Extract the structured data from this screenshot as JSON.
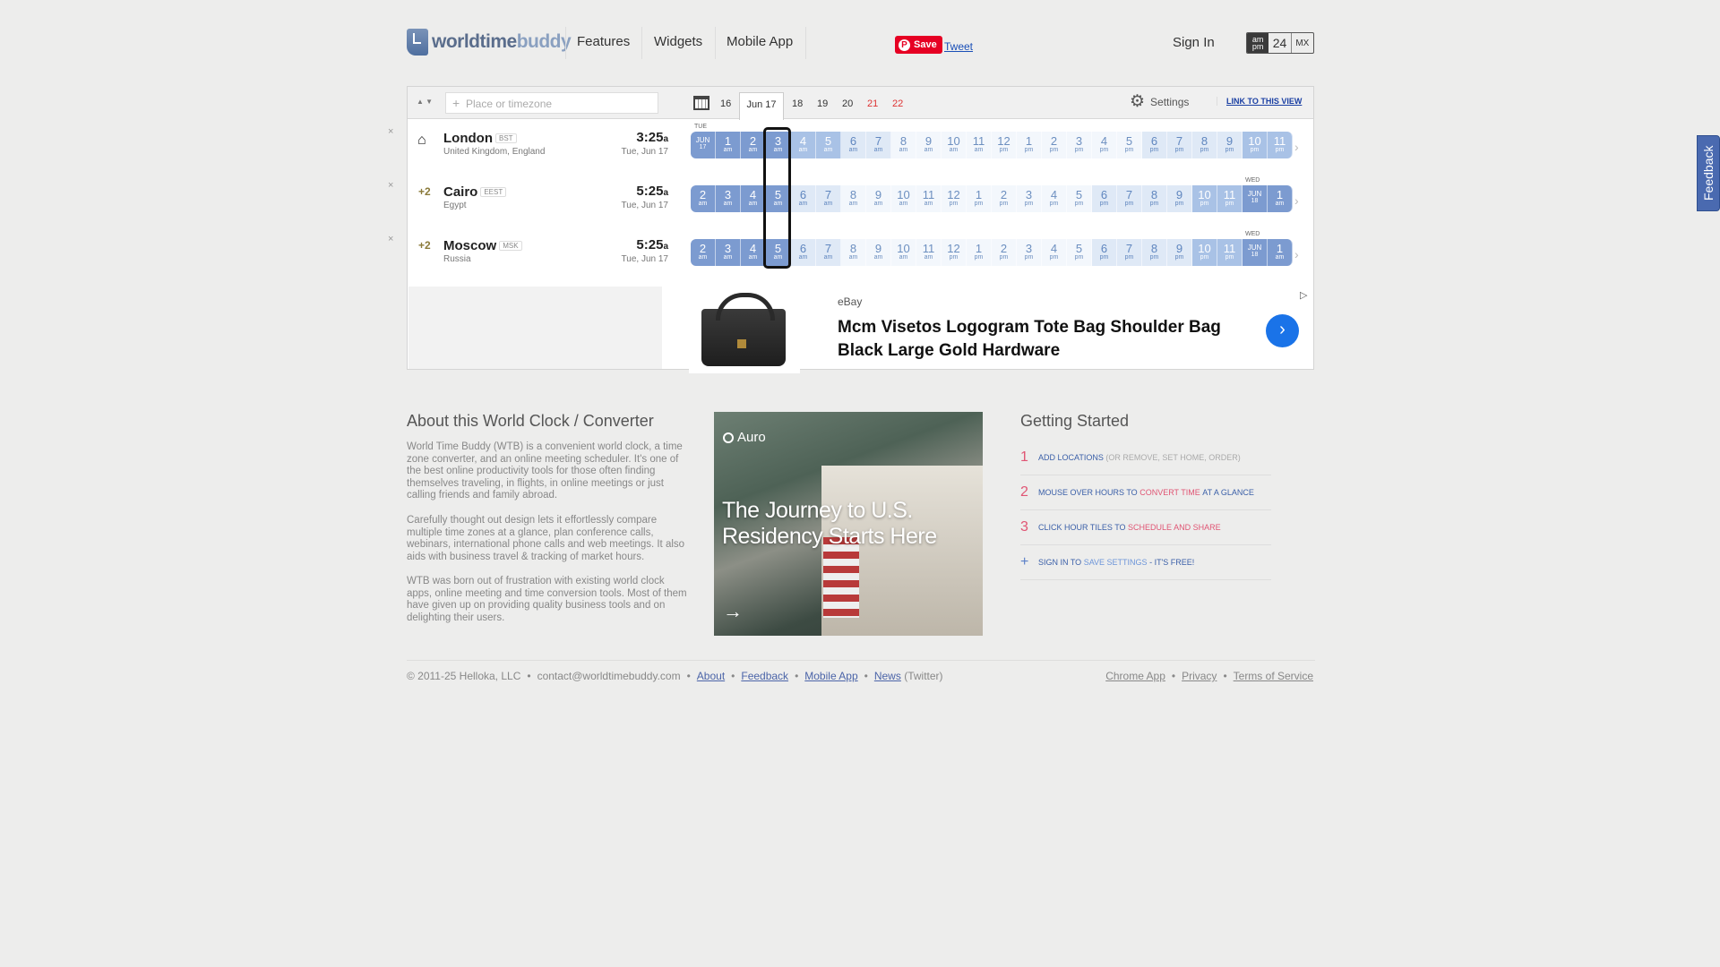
{
  "header": {
    "logo_word": "worldtime",
    "logo_word2": "buddy",
    "nav": [
      "Features",
      "Widgets",
      "Mobile App"
    ],
    "pin_label": "Save",
    "tweet_label": "Tweet",
    "signin": "Sign In",
    "format": {
      "ampm": "am pm",
      "h24": "24",
      "mx": "MX"
    }
  },
  "toolbar": {
    "search_placeholder": "Place or timezone",
    "days": [
      "16",
      "Jun 17",
      "18",
      "19",
      "20",
      "21",
      "22"
    ],
    "weekend_days": [
      "21",
      "22"
    ],
    "settings": "Settings",
    "link_view": "LINK TO THIS VIEW"
  },
  "locations": [
    {
      "diff": "",
      "city": "London",
      "tz": "BST",
      "country": "United Kingdom, England",
      "time": "3:25",
      "suffix": "a",
      "date": "Tue, Jun 17",
      "home": true
    },
    {
      "diff": "+2",
      "city": "Cairo",
      "tz": "EEST",
      "country": "Egypt",
      "time": "5:25",
      "suffix": "a",
      "date": "Tue, Jun 17"
    },
    {
      "diff": "+2",
      "city": "Moscow",
      "tz": "MSK",
      "country": "Russia",
      "time": "5:25",
      "suffix": "a",
      "date": "Tue, Jun 17"
    }
  ],
  "day_labels": {
    "tue": "TUE",
    "wed": "WED"
  },
  "row1_hours": [
    {
      "t": "JUN",
      "s": "17",
      "k": "jun"
    },
    {
      "t": "1",
      "s": "am",
      "k": "night"
    },
    {
      "t": "2",
      "s": "am",
      "k": "night"
    },
    {
      "t": "3",
      "s": "am",
      "k": "night"
    },
    {
      "t": "4",
      "s": "am",
      "k": "dawn"
    },
    {
      "t": "5",
      "s": "am",
      "k": "dawn"
    },
    {
      "t": "6",
      "s": "am",
      "k": "hd"
    },
    {
      "t": "7",
      "s": "am",
      "k": "hd"
    },
    {
      "t": "8",
      "s": "am",
      "k": "mid"
    },
    {
      "t": "9",
      "s": "am",
      "k": "mid"
    },
    {
      "t": "10",
      "s": "am",
      "k": "mid"
    },
    {
      "t": "11",
      "s": "am",
      "k": "mid"
    },
    {
      "t": "12",
      "s": "pm",
      "k": "mid"
    },
    {
      "t": "1",
      "s": "pm",
      "k": "mid"
    },
    {
      "t": "2",
      "s": "pm",
      "k": "mid"
    },
    {
      "t": "3",
      "s": "pm",
      "k": "mid"
    },
    {
      "t": "4",
      "s": "pm",
      "k": "mid"
    },
    {
      "t": "5",
      "s": "pm",
      "k": "mid"
    },
    {
      "t": "6",
      "s": "pm",
      "k": "hd"
    },
    {
      "t": "7",
      "s": "pm",
      "k": "hd"
    },
    {
      "t": "8",
      "s": "pm",
      "k": "hd"
    },
    {
      "t": "9",
      "s": "pm",
      "k": "hd"
    },
    {
      "t": "10",
      "s": "pm",
      "k": "dawn"
    },
    {
      "t": "11",
      "s": "pm",
      "k": "dawn"
    }
  ],
  "row23_hours": [
    {
      "t": "2",
      "s": "am",
      "k": "night"
    },
    {
      "t": "3",
      "s": "am",
      "k": "night"
    },
    {
      "t": "4",
      "s": "am",
      "k": "night"
    },
    {
      "t": "5",
      "s": "am",
      "k": "night"
    },
    {
      "t": "6",
      "s": "am",
      "k": "hd"
    },
    {
      "t": "7",
      "s": "am",
      "k": "hd"
    },
    {
      "t": "8",
      "s": "am",
      "k": "mid"
    },
    {
      "t": "9",
      "s": "am",
      "k": "mid"
    },
    {
      "t": "10",
      "s": "am",
      "k": "mid"
    },
    {
      "t": "11",
      "s": "am",
      "k": "mid"
    },
    {
      "t": "12",
      "s": "pm",
      "k": "mid"
    },
    {
      "t": "1",
      "s": "pm",
      "k": "mid"
    },
    {
      "t": "2",
      "s": "pm",
      "k": "mid"
    },
    {
      "t": "3",
      "s": "pm",
      "k": "mid"
    },
    {
      "t": "4",
      "s": "pm",
      "k": "mid"
    },
    {
      "t": "5",
      "s": "pm",
      "k": "mid"
    },
    {
      "t": "6",
      "s": "pm",
      "k": "hd"
    },
    {
      "t": "7",
      "s": "pm",
      "k": "hd"
    },
    {
      "t": "8",
      "s": "pm",
      "k": "hd"
    },
    {
      "t": "9",
      "s": "pm",
      "k": "hd"
    },
    {
      "t": "10",
      "s": "pm",
      "k": "dawn"
    },
    {
      "t": "11",
      "s": "pm",
      "k": "dawn"
    },
    {
      "t": "JUN",
      "s": "18",
      "k": "jun"
    },
    {
      "t": "1",
      "s": "am",
      "k": "night"
    }
  ],
  "ad": {
    "source": "eBay",
    "title": "Mcm Visetos Logogram Tote Bag Shoulder Bag Black Large Gold Hardware"
  },
  "about": {
    "heading": "About this World Clock / Converter",
    "p1": "World Time Buddy (WTB) is a convenient world clock, a time zone converter, and an online meeting scheduler. It's one of the best online productivity tools for those often finding themselves traveling, in flights, in online meetings or just calling friends and family abroad.",
    "p2": "Carefully thought out design lets it effortlessly compare multiple time zones at a glance, plan conference calls, webinars, international phone calls and web meetings. It also aids with business travel & tracking of market hours.",
    "p3": "WTB was born out of frustration with existing world clock apps, online meeting and time conversion tools. Most of them have given up on providing quality business tools and on delighting their users."
  },
  "ad2": {
    "brand": "Auro",
    "headline": "The Journey to U.S. Residency Starts Here"
  },
  "getting_started": {
    "heading": "Getting Started",
    "steps": [
      {
        "n": "1",
        "a": "ADD LOCATIONS",
        "b": "(OR REMOVE, SET HOME, ORDER)",
        "c": ""
      },
      {
        "n": "2",
        "a": "MOUSE OVER HOURS TO",
        "b": "CONVERT TIME",
        "c": "AT A GLANCE"
      },
      {
        "n": "3",
        "a": "CLICK HOUR TILES TO",
        "b": "SCHEDULE AND SHARE",
        "c": ""
      },
      {
        "n": "+",
        "a": "SIGN IN TO",
        "b": "SAVE SETTINGS",
        "c": "- IT'S FREE!"
      }
    ]
  },
  "footer": {
    "copyright": "© 2011-25 Helloka, LLC",
    "email": "contact@worldtimebuddy.com",
    "about": "About",
    "feedback": "Feedback",
    "mobile": "Mobile App",
    "news": "News",
    "twitter": "(Twitter)",
    "chrome": "Chrome App",
    "privacy": "Privacy",
    "terms": "Terms of Service",
    "sep": "•"
  },
  "feedback_tab": "Feedback"
}
